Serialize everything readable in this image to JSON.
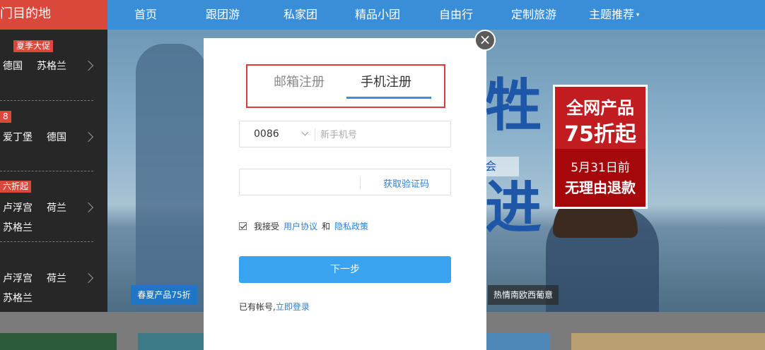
{
  "header": {
    "dest_title": "门目的地",
    "nav": [
      "首页",
      "跟团游",
      "私家团",
      "精品小团",
      "自由行",
      "定制旅游",
      "主题推荐"
    ]
  },
  "side": {
    "blocks": [
      {
        "badge": "夏季大促",
        "items": [
          "德国",
          "苏格兰"
        ]
      },
      {
        "badge": "8",
        "items": [
          "爱丁堡",
          "德国"
        ]
      },
      {
        "badge": "六折起",
        "items": [
          "卢浮宫",
          "荷兰"
        ],
        "extra": "苏格兰"
      },
      {
        "items": [
          "卢浮宫",
          "荷兰"
        ],
        "extra": "苏格兰"
      }
    ]
  },
  "hero": {
    "promo_l1": "全网产品",
    "promo_l2": "75折起",
    "promo_l3": "5月31日前",
    "promo_l4": "无理由退款",
    "tag_left": "春夏产品75折",
    "tag_right": "热情南欧西葡意",
    "big1": "牲",
    "sub": "会",
    "big2": "进"
  },
  "modal": {
    "close": "×",
    "tab_email": "邮箱注册",
    "tab_phone": "手机注册",
    "country_code": "0086",
    "phone_placeholder": "新手机号",
    "code_value": "",
    "get_code": "获取验证码",
    "agree_prefix": "我接受",
    "user_agreement": "用户协议",
    "and": "和",
    "privacy": "隐私政策",
    "next": "下一步",
    "have_account": "已有帐号,",
    "login_now": "立即登录"
  },
  "colors": {
    "accent_blue": "#3b8fe0",
    "nav_blue": "#3a8ed8",
    "red": "#d9483b",
    "button": "#3aa3ef"
  }
}
